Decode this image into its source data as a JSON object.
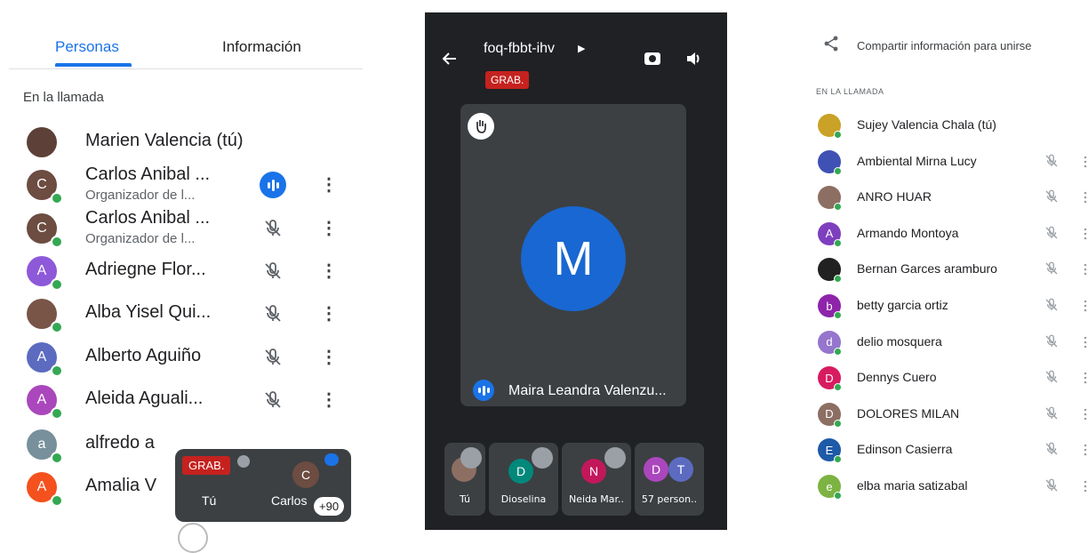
{
  "left": {
    "tabs": [
      "Personas",
      "Información"
    ],
    "section": "En la llamada",
    "participants": [
      {
        "name": "Marien Valencia (tú)",
        "sub": "",
        "avatar": "",
        "color": "#5d4037",
        "status": "none",
        "photo": true
      },
      {
        "name": "Carlos Anibal ...",
        "sub": "Organizador de l...",
        "avatar": "C",
        "color": "#6d4c41",
        "status": "speaking"
      },
      {
        "name": "Carlos Anibal ...",
        "sub": "Organizador de l...",
        "avatar": "C",
        "color": "#6d4c41",
        "status": "muted"
      },
      {
        "name": "Adriegne Flor...",
        "sub": "",
        "avatar": "A",
        "color": "#8e59d9",
        "status": "muted"
      },
      {
        "name": "Alba Yisel Qui...",
        "sub": "",
        "avatar": "",
        "color": "#795548",
        "status": "muted",
        "photo": true
      },
      {
        "name": "Alberto Aguiño",
        "sub": "",
        "avatar": "A",
        "color": "#5c6bc0",
        "status": "muted"
      },
      {
        "name": "Aleida Aguali...",
        "sub": "",
        "avatar": "A",
        "color": "#ab47bc",
        "status": "muted"
      },
      {
        "name": "alfredo a",
        "sub": "",
        "avatar": "a",
        "color": "#78909c",
        "status": "none"
      },
      {
        "name": "Amalia V",
        "sub": "",
        "avatar": "A",
        "color": "#f4511e",
        "status": "none"
      }
    ],
    "pip": {
      "badge": "GRAB.",
      "self_label": "Tú",
      "other_label": "Carlos",
      "other_avatar": "C",
      "count": "+90"
    }
  },
  "middle": {
    "meeting_code": "foq-fbbt-ihv",
    "rec_badge": "GRAB.",
    "main_avatar": "M",
    "main_name": "Maira Leandra Valenzu...",
    "thumbs": [
      {
        "label": "Tú",
        "avatar": ""
      },
      {
        "label": "Dioselina",
        "avatar": "D"
      },
      {
        "label": "Neida Mar..",
        "avatar": "N"
      },
      {
        "label": "57 person..",
        "avatar": "D",
        "avatar2": "T"
      }
    ]
  },
  "right": {
    "share": "Compartir información para unirse",
    "section": "EN LA LLAMADA",
    "participants": [
      {
        "name": "Sujey Valencia Chala (tú)",
        "avatar": "",
        "color": "#c9a227",
        "muted": false
      },
      {
        "name": "Ambiental Mirna Lucy",
        "avatar": "",
        "color": "#3f51b5",
        "muted": true
      },
      {
        "name": "ANRO HUAR",
        "avatar": "",
        "color": "#8d6e63",
        "muted": true
      },
      {
        "name": "Armando Montoya",
        "avatar": "A",
        "color": "#7e3fbf",
        "muted": true
      },
      {
        "name": "Bernan Garces aramburo",
        "avatar": "",
        "color": "#212121",
        "muted": true
      },
      {
        "name": "betty garcia ortiz",
        "avatar": "b",
        "color": "#8e24aa",
        "muted": true
      },
      {
        "name": "delio mosquera",
        "avatar": "d",
        "color": "#9575cd",
        "muted": true
      },
      {
        "name": "Dennys Cuero",
        "avatar": "D",
        "color": "#d81b60",
        "muted": true
      },
      {
        "name": "DOLORES MILAN",
        "avatar": "D",
        "color": "#8d6e63",
        "muted": true
      },
      {
        "name": "Edinson Casierra",
        "avatar": "E",
        "color": "#1e5aa8",
        "muted": true
      },
      {
        "name": "elba maria satizabal",
        "avatar": "e",
        "color": "#7cb342",
        "muted": true
      }
    ]
  }
}
